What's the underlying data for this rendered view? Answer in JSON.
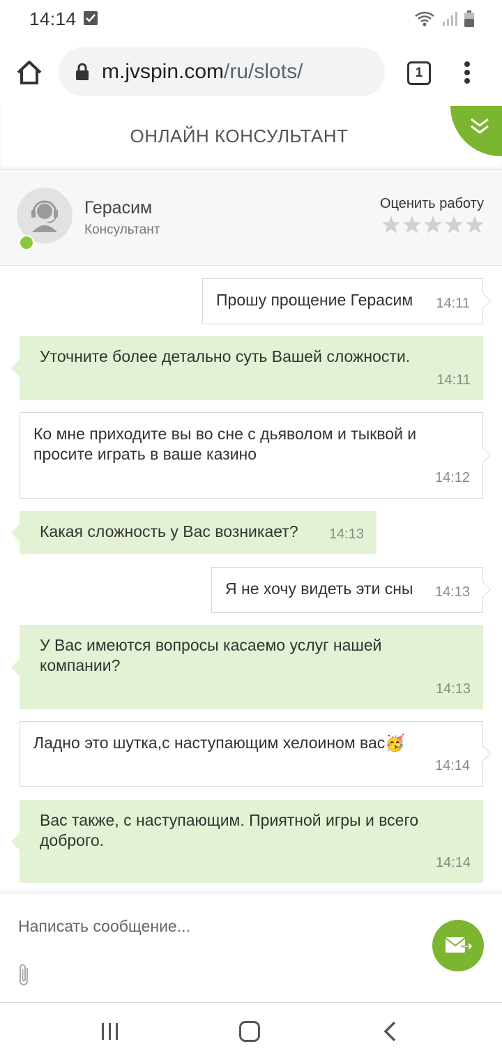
{
  "status_bar": {
    "time": "14:14"
  },
  "browser": {
    "url_host": "m.jvspin.com",
    "url_path": "/ru/slots/",
    "tab_count": "1"
  },
  "chat": {
    "title": "ОНЛАЙН КОНСУЛЬТАНТ",
    "operator": {
      "name": "Герасим",
      "role": "Консультант",
      "rate_label": "Оценить работу",
      "rating": 0,
      "max_rating": 5
    },
    "messages": [
      {
        "from": "user",
        "text": "Прошу прощение Герасим",
        "time": "14:11"
      },
      {
        "from": "agent",
        "text": "Уточните более детально суть Вашей сложности.",
        "time": "14:11"
      },
      {
        "from": "user",
        "text": "Ко мне приходите вы во сне с дьяволом и тыквой и просите играть в ваше казино",
        "time": "14:12"
      },
      {
        "from": "agent",
        "text": "Какая сложность у Вас возникает?",
        "time": "14:13"
      },
      {
        "from": "user",
        "text": "Я не хочу видеть эти сны",
        "time": "14:13"
      },
      {
        "from": "agent",
        "text": "У Вас имеются вопросы касаемо услуг нашей компании?",
        "time": "14:13"
      },
      {
        "from": "user",
        "text": "Ладно это шутка,с наступающим хелоином вас🥳",
        "time": "14:14"
      },
      {
        "from": "agent",
        "text": "Вас также, с наступающим. Приятной игры и всего доброго.",
        "time": "14:14"
      }
    ],
    "input_placeholder": "Написать сообщение..."
  },
  "colors": {
    "accent": "#7cb530",
    "agent_bubble": "#e3f2d4",
    "online": "#8cc63f"
  },
  "icons": [
    "home-icon",
    "lock-icon",
    "tabs-icon",
    "menu-icon",
    "chevron-down-icon",
    "headset-avatar-icon",
    "star-icon",
    "paperclip-icon",
    "send-mail-icon"
  ]
}
